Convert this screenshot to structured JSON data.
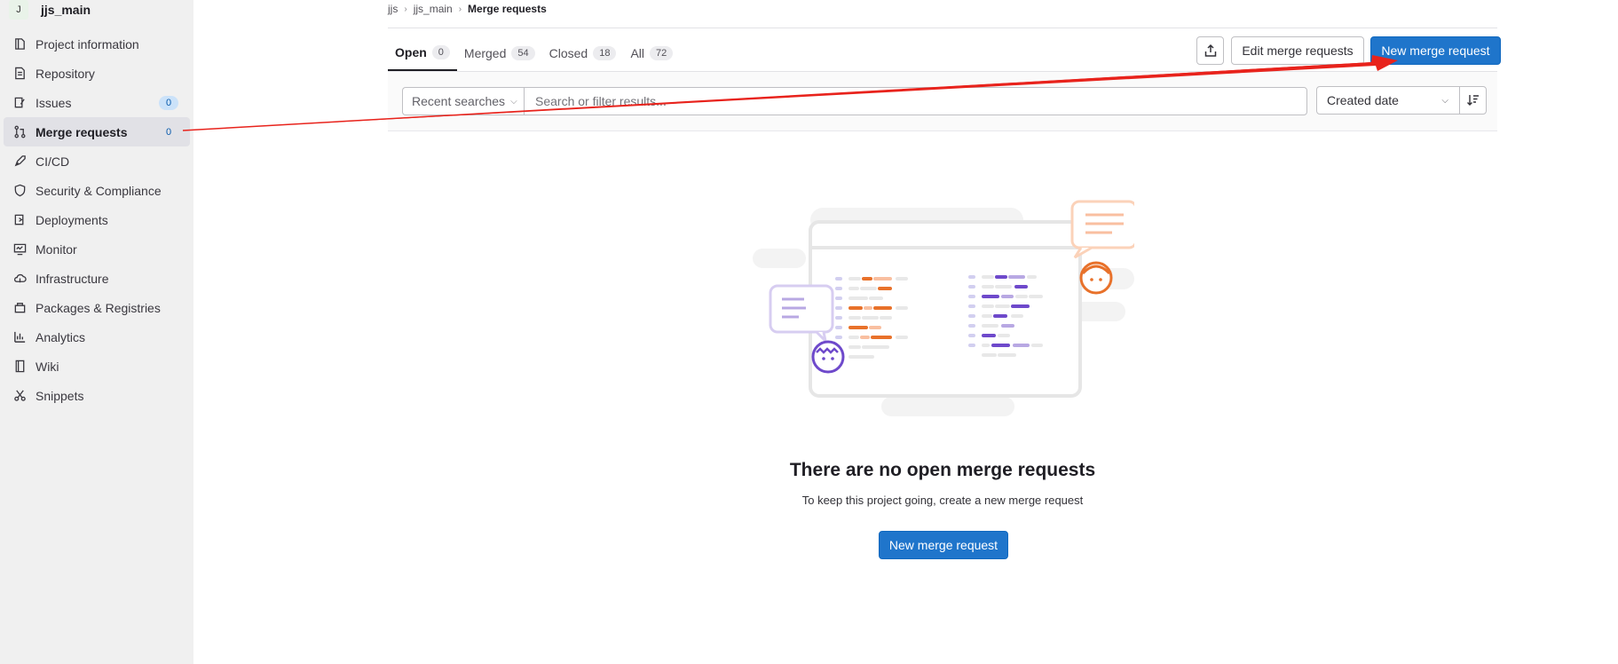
{
  "project": {
    "avatar_letter": "J",
    "name": "jjs_main"
  },
  "sidebar": {
    "items": [
      {
        "label": "Project information",
        "icon": "project-info-icon"
      },
      {
        "label": "Repository",
        "icon": "repository-icon"
      },
      {
        "label": "Issues",
        "icon": "issues-icon",
        "badge": "0"
      },
      {
        "label": "Merge requests",
        "icon": "merge-request-icon",
        "badge": "0",
        "active": true
      },
      {
        "label": "CI/CD",
        "icon": "rocket-icon"
      },
      {
        "label": "Security & Compliance",
        "icon": "shield-icon"
      },
      {
        "label": "Deployments",
        "icon": "deployments-icon"
      },
      {
        "label": "Monitor",
        "icon": "monitor-icon"
      },
      {
        "label": "Infrastructure",
        "icon": "cloud-icon"
      },
      {
        "label": "Packages & Registries",
        "icon": "package-icon"
      },
      {
        "label": "Analytics",
        "icon": "chart-icon"
      },
      {
        "label": "Wiki",
        "icon": "book-icon"
      },
      {
        "label": "Snippets",
        "icon": "scissors-icon"
      }
    ]
  },
  "breadcrumb": {
    "items": [
      "jjs",
      "jjs_main"
    ],
    "current": "Merge requests"
  },
  "tabs": [
    {
      "label": "Open",
      "count": "0",
      "active": true
    },
    {
      "label": "Merged",
      "count": "54"
    },
    {
      "label": "Closed",
      "count": "18"
    },
    {
      "label": "All",
      "count": "72"
    }
  ],
  "actions": {
    "edit_label": "Edit merge requests",
    "new_label": "New merge request"
  },
  "filter": {
    "recent_label": "Recent searches",
    "search_placeholder": "Search or filter results...",
    "sort_label": "Created date"
  },
  "empty_state": {
    "title": "There are no open merge requests",
    "description": "To keep this project going, create a new merge request",
    "button_label": "New merge request"
  },
  "colors": {
    "primary": "#1f75cb",
    "annotation_arrow": "#e8231c",
    "accent_orange": "#e8712a",
    "accent_purple": "#6e49cb"
  }
}
